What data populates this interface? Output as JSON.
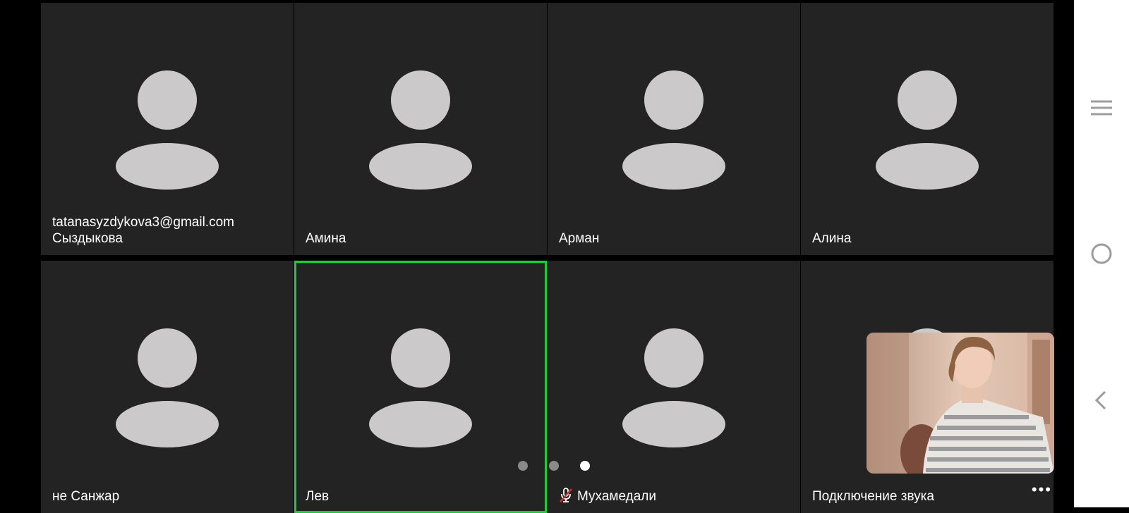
{
  "participants": [
    {
      "name_line1": "tatanasyzdykova3@gmail.com",
      "name_line2": "Сыздыкова"
    },
    {
      "name": "Амина"
    },
    {
      "name": "Арман"
    },
    {
      "name": "Алина"
    },
    {
      "name": "не Санжар"
    },
    {
      "name": "Лев",
      "active_speaker": true
    },
    {
      "name": "Мухамедали",
      "muted": true
    },
    {
      "name": "Подключение звука",
      "more_menu": "•••"
    }
  ],
  "pagination": {
    "pages": 3,
    "current": 3
  },
  "self_view": {
    "type": "camera-preview"
  },
  "system_nav": {
    "icons": [
      "menu-icon",
      "home-circle-icon",
      "back-chevron-icon"
    ]
  },
  "colors": {
    "tile_bg": "#232323",
    "avatar": "#cbc9c9",
    "active_border": "#1ecb3c",
    "muted_red": "#d9342b"
  }
}
